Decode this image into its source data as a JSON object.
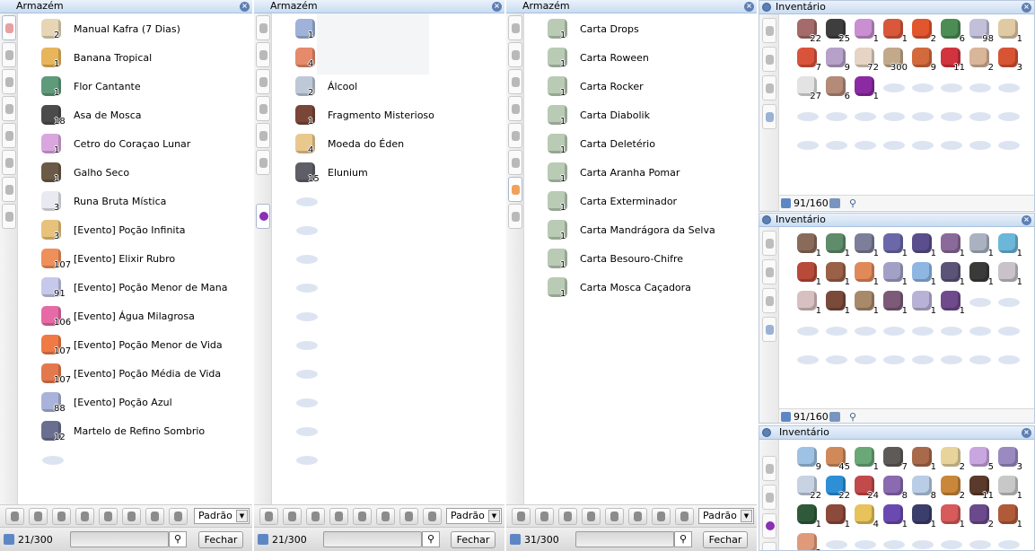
{
  "storage_panels": [
    {
      "title": "Armazém",
      "sort_label": "Padrão",
      "count": "21/300",
      "close_label": "Fechar",
      "items": [
        {
          "name": "Manual Kafra (7 Dias)",
          "qty": "2",
          "color": "#e7d6b6"
        },
        {
          "name": "Banana Tropical",
          "qty": "1",
          "color": "#e7b55b"
        },
        {
          "name": "Flor Cantante",
          "qty": "1",
          "color": "#5f9a7a"
        },
        {
          "name": "Asa de Mosca",
          "qty": "18",
          "color": "#4b4b4b"
        },
        {
          "name": "Cetro do Coraçao Lunar",
          "qty": "1",
          "color": "#d9a6e0"
        },
        {
          "name": "Galho Seco",
          "qty": "1",
          "color": "#6b5a45"
        },
        {
          "name": "Runa Bruta Mística",
          "qty": "3",
          "color": "#e9e9f2"
        },
        {
          "name": "[Evento] Poção Infinita",
          "qty": "3",
          "color": "#e6c27a"
        },
        {
          "name": "[Evento] Elixir Rubro",
          "qty": "107",
          "color": "#ef8f5a"
        },
        {
          "name": "[Evento] Poção Menor de Mana",
          "qty": "91",
          "color": "#c6c9ea"
        },
        {
          "name": "[Evento] Água Milagrosa",
          "qty": "106",
          "color": "#e66aa5"
        },
        {
          "name": "[Evento] Poção Menor de Vida",
          "qty": "107",
          "color": "#f07a45"
        },
        {
          "name": "[Evento] Poção Média de Vida",
          "qty": "107",
          "color": "#e4784d"
        },
        {
          "name": "[Evento] Poção Azul",
          "qty": "88",
          "color": "#a9b3da"
        },
        {
          "name": "Martelo de Refino Sombrio",
          "qty": "12",
          "color": "#6a6f8f"
        }
      ]
    },
    {
      "title": "Armazém",
      "sort_label": "Padrão",
      "count": "21/300",
      "close_label": "Fechar",
      "items": [
        {
          "name": "",
          "qty": "1",
          "color": "#9fb2d9"
        },
        {
          "name": "",
          "qty": "4",
          "color": "#e58a6a"
        },
        {
          "name": "Álcool",
          "qty": "2",
          "color": "#bfc8d8"
        },
        {
          "name": "Fragmento Misterioso",
          "qty": "1",
          "color": "#7a4638"
        },
        {
          "name": "Moeda do Éden",
          "qty": "4",
          "color": "#e9c88e"
        },
        {
          "name": "Elunium",
          "qty": "15",
          "color": "#5e5e66"
        }
      ]
    },
    {
      "title": "Armazém",
      "sort_label": "Padrão",
      "count": "31/300",
      "close_label": "Fechar",
      "items": [
        {
          "name": "Carta Drops",
          "qty": "1",
          "color": "#b9cbb4"
        },
        {
          "name": "Carta Roween",
          "qty": "1",
          "color": "#b9cbb4"
        },
        {
          "name": "Carta Rocker",
          "qty": "1",
          "color": "#b9cbb4"
        },
        {
          "name": "Carta Diabolik",
          "qty": "1",
          "color": "#b9cbb4"
        },
        {
          "name": "Carta Deletério",
          "qty": "1",
          "color": "#b9cbb4"
        },
        {
          "name": "Carta Aranha Pomar",
          "qty": "1",
          "color": "#b9cbb4"
        },
        {
          "name": "Carta Exterminador",
          "qty": "1",
          "color": "#b9cbb4"
        },
        {
          "name": "Carta Mandrágora da Selva",
          "qty": "1",
          "color": "#b9cbb4"
        },
        {
          "name": "Carta Besouro-Chifre",
          "qty": "1",
          "color": "#b9cbb4"
        },
        {
          "name": "Carta Mosca Caçadora",
          "qty": "1",
          "color": "#b9cbb4"
        }
      ]
    }
  ],
  "inventory_panels": [
    {
      "title": "Inventário",
      "count": "91/160",
      "cells": [
        {
          "qty": "22",
          "color": "#a56a6a"
        },
        {
          "qty": "25",
          "color": "#3e3e3e"
        },
        {
          "qty": "1",
          "color": "#c98fd1"
        },
        {
          "qty": "1",
          "color": "#d9573b"
        },
        {
          "qty": "2",
          "color": "#e1562c"
        },
        {
          "qty": "6",
          "color": "#4c8c55"
        },
        {
          "qty": "98",
          "color": "#c2bfd9"
        },
        {
          "qty": "1",
          "color": "#e0caa4"
        },
        {
          "qty": "7",
          "color": "#d9533b"
        },
        {
          "qty": "9",
          "color": "#b6a2c9"
        },
        {
          "qty": "72",
          "color": "#e6d4c4"
        },
        {
          "qty": "300",
          "color": "#c2a98a"
        },
        {
          "qty": "9",
          "color": "#d26a3d"
        },
        {
          "qty": "11",
          "color": "#d1333f"
        },
        {
          "qty": "2",
          "color": "#d9b59a"
        },
        {
          "qty": "3",
          "color": "#d75435"
        },
        {
          "qty": "27",
          "color": "#e3e3e3"
        },
        {
          "qty": "6",
          "color": "#b48a78"
        },
        {
          "qty": "1",
          "color": "#8c2aa3"
        },
        {
          "qty": "",
          "color": ""
        },
        {
          "qty": "",
          "color": ""
        },
        {
          "qty": "",
          "color": ""
        },
        {
          "qty": "",
          "color": ""
        },
        {
          "qty": "",
          "color": ""
        },
        {
          "qty": "",
          "color": ""
        },
        {
          "qty": "",
          "color": ""
        },
        {
          "qty": "",
          "color": ""
        },
        {
          "qty": "",
          "color": ""
        },
        {
          "qty": "",
          "color": ""
        },
        {
          "qty": "",
          "color": ""
        },
        {
          "qty": "",
          "color": ""
        },
        {
          "qty": "",
          "color": ""
        },
        {
          "qty": "",
          "color": ""
        },
        {
          "qty": "",
          "color": ""
        },
        {
          "qty": "",
          "color": ""
        },
        {
          "qty": "",
          "color": ""
        },
        {
          "qty": "",
          "color": ""
        },
        {
          "qty": "",
          "color": ""
        },
        {
          "qty": "",
          "color": ""
        },
        {
          "qty": "",
          "color": ""
        }
      ]
    },
    {
      "title": "Inventário",
      "count": "91/160",
      "cells": [
        {
          "qty": "1",
          "color": "#8a6b5a"
        },
        {
          "qty": "1",
          "color": "#5f8c6a"
        },
        {
          "qty": "1",
          "color": "#7d7f9a"
        },
        {
          "qty": "1",
          "color": "#6b67a8"
        },
        {
          "qty": "1",
          "color": "#5a4f8c"
        },
        {
          "qty": "1",
          "color": "#8a6a9a"
        },
        {
          "qty": "1",
          "color": "#aab2c2"
        },
        {
          "qty": "1",
          "color": "#6bb7d9"
        },
        {
          "qty": "1",
          "color": "#b84a3a"
        },
        {
          "qty": "1",
          "color": "#9a6048"
        },
        {
          "qty": "1",
          "color": "#e08a5a"
        },
        {
          "qty": "1",
          "color": "#a3a0c8"
        },
        {
          "qty": "1",
          "color": "#8fb6e3"
        },
        {
          "qty": "1",
          "color": "#5b5478"
        },
        {
          "qty": "1",
          "color": "#3a3a3a"
        },
        {
          "qty": "1",
          "color": "#c9c2c9"
        },
        {
          "qty": "1",
          "color": "#d9c0c0"
        },
        {
          "qty": "1",
          "color": "#7a4a3a"
        },
        {
          "qty": "1",
          "color": "#a88a6a"
        },
        {
          "qty": "1",
          "color": "#7c5a78"
        },
        {
          "qty": "1",
          "color": "#b8b3d6"
        },
        {
          "qty": "1",
          "color": "#6f4a8c"
        },
        {
          "qty": "",
          "color": ""
        },
        {
          "qty": "",
          "color": ""
        },
        {
          "qty": "",
          "color": ""
        },
        {
          "qty": "",
          "color": ""
        },
        {
          "qty": "",
          "color": ""
        },
        {
          "qty": "",
          "color": ""
        },
        {
          "qty": "",
          "color": ""
        },
        {
          "qty": "",
          "color": ""
        },
        {
          "qty": "",
          "color": ""
        },
        {
          "qty": "",
          "color": ""
        },
        {
          "qty": "",
          "color": ""
        },
        {
          "qty": "",
          "color": ""
        },
        {
          "qty": "",
          "color": ""
        },
        {
          "qty": "",
          "color": ""
        },
        {
          "qty": "",
          "color": ""
        },
        {
          "qty": "",
          "color": ""
        },
        {
          "qty": "",
          "color": ""
        },
        {
          "qty": "",
          "color": ""
        }
      ]
    },
    {
      "title": "Inventário",
      "cells": [
        {
          "qty": "9",
          "color": "#9ec2e3"
        },
        {
          "qty": "45",
          "color": "#d08a5a"
        },
        {
          "qty": "1",
          "color": "#6aa878"
        },
        {
          "qty": "7",
          "color": "#5e5a58"
        },
        {
          "qty": "1",
          "color": "#a86a4a"
        },
        {
          "qty": "2",
          "color": "#e8d49a"
        },
        {
          "qty": "5",
          "color": "#c9a6e0"
        },
        {
          "qty": "3",
          "color": "#9a8ac0"
        },
        {
          "qty": "22",
          "color": "#c7d2e3"
        },
        {
          "qty": "22",
          "color": "#2e8fd6"
        },
        {
          "qty": "24",
          "color": "#c24a4a"
        },
        {
          "qty": "8",
          "color": "#8a6ab0"
        },
        {
          "qty": "8",
          "color": "#b9cde6"
        },
        {
          "qty": "2",
          "color": "#c9873a"
        },
        {
          "qty": "11",
          "color": "#5a3a2a"
        },
        {
          "qty": "1",
          "color": "#c8c8c8"
        },
        {
          "qty": "1",
          "color": "#2f5a3a"
        },
        {
          "qty": "1",
          "color": "#8c4a3a"
        },
        {
          "qty": "4",
          "color": "#e8c25a"
        },
        {
          "qty": "1",
          "color": "#6a4ab0"
        },
        {
          "qty": "1",
          "color": "#3a3e6a"
        },
        {
          "qty": "1",
          "color": "#d85a5a"
        },
        {
          "qty": "2",
          "color": "#6b4a8c"
        },
        {
          "qty": "1",
          "color": "#b05a3a"
        },
        {
          "qty": "2",
          "color": "#e09a7a"
        },
        {
          "qty": "",
          "color": ""
        },
        {
          "qty": "",
          "color": ""
        },
        {
          "qty": "",
          "color": ""
        },
        {
          "qty": "",
          "color": ""
        },
        {
          "qty": "",
          "color": ""
        },
        {
          "qty": "",
          "color": ""
        },
        {
          "qty": "",
          "color": ""
        }
      ]
    }
  ],
  "filter_icons": [
    "potion-icon",
    "ring-icon",
    "armor-icon",
    "sword-icon",
    "paw-icon",
    "wand-icon",
    "card-icon",
    "orb-icon"
  ]
}
